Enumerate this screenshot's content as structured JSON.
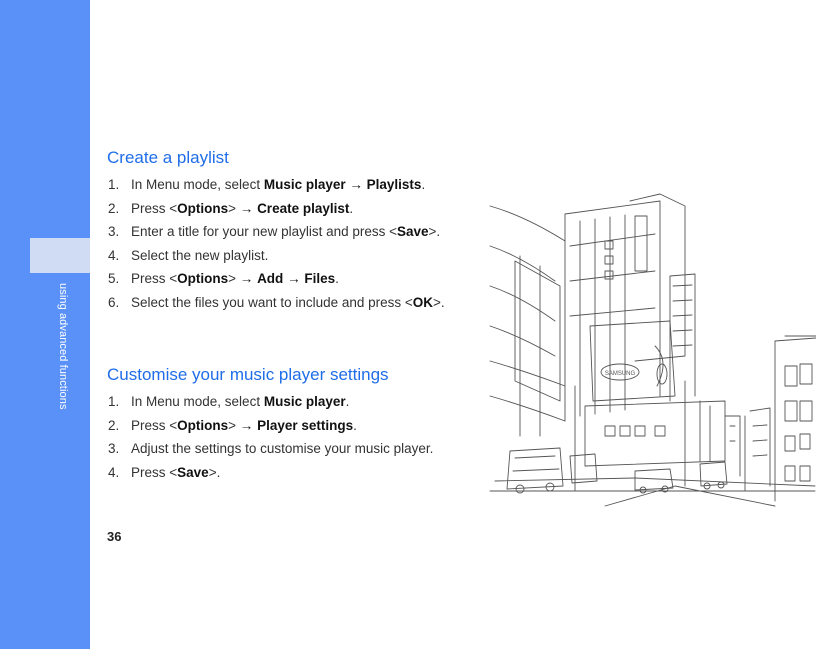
{
  "sidebar": {
    "label": "using advanced functions"
  },
  "page_number": "36",
  "section1": {
    "title": "Create a playlist",
    "steps": [
      {
        "num": "1.",
        "parts": [
          {
            "t": "In Menu mode, select "
          },
          {
            "t": "Music player",
            "b": true
          },
          {
            "t": " → ",
            "arrow": true
          },
          {
            "t": "Playlists",
            "b": true
          },
          {
            "t": "."
          }
        ]
      },
      {
        "num": "2.",
        "parts": [
          {
            "t": "Press <"
          },
          {
            "t": "Options",
            "b": true
          },
          {
            "t": "> "
          },
          {
            "t": "→ ",
            "arrow": true
          },
          {
            "t": "Create playlist",
            "b": true
          },
          {
            "t": "."
          }
        ]
      },
      {
        "num": "3.",
        "parts": [
          {
            "t": "Enter a title for your new playlist and press <"
          },
          {
            "t": "Save",
            "b": true
          },
          {
            "t": ">."
          }
        ]
      },
      {
        "num": "4.",
        "parts": [
          {
            "t": "Select the new playlist."
          }
        ]
      },
      {
        "num": "5.",
        "parts": [
          {
            "t": "Press <"
          },
          {
            "t": "Options",
            "b": true
          },
          {
            "t": "> "
          },
          {
            "t": "→ ",
            "arrow": true
          },
          {
            "t": "Add",
            "b": true
          },
          {
            "t": " → ",
            "arrow": true
          },
          {
            "t": "Files",
            "b": true
          },
          {
            "t": "."
          }
        ]
      },
      {
        "num": "6.",
        "parts": [
          {
            "t": "Select the files you want to include and press <"
          },
          {
            "t": "OK",
            "b": true
          },
          {
            "t": ">."
          }
        ]
      }
    ]
  },
  "section2": {
    "title": "Customise your music player settings",
    "steps": [
      {
        "num": "1.",
        "parts": [
          {
            "t": "In Menu mode, select "
          },
          {
            "t": "Music player",
            "b": true
          },
          {
            "t": "."
          }
        ]
      },
      {
        "num": "2.",
        "parts": [
          {
            "t": "Press <"
          },
          {
            "t": "Options",
            "b": true
          },
          {
            "t": "> "
          },
          {
            "t": "→ ",
            "arrow": true
          },
          {
            "t": "Player settings",
            "b": true
          },
          {
            "t": "."
          }
        ]
      },
      {
        "num": "3.",
        "parts": [
          {
            "t": "Adjust the settings to customise your music player."
          }
        ]
      },
      {
        "num": "4.",
        "parts": [
          {
            "t": "Press <"
          },
          {
            "t": "Save",
            "b": true
          },
          {
            "t": ">."
          }
        ]
      }
    ]
  },
  "illustration": {
    "sign_text": "SAMSUNG"
  },
  "colors": {
    "sidebar": "#5a91f8",
    "sidebar_tab": "#cfdcf3",
    "heading": "#1f6de8"
  }
}
